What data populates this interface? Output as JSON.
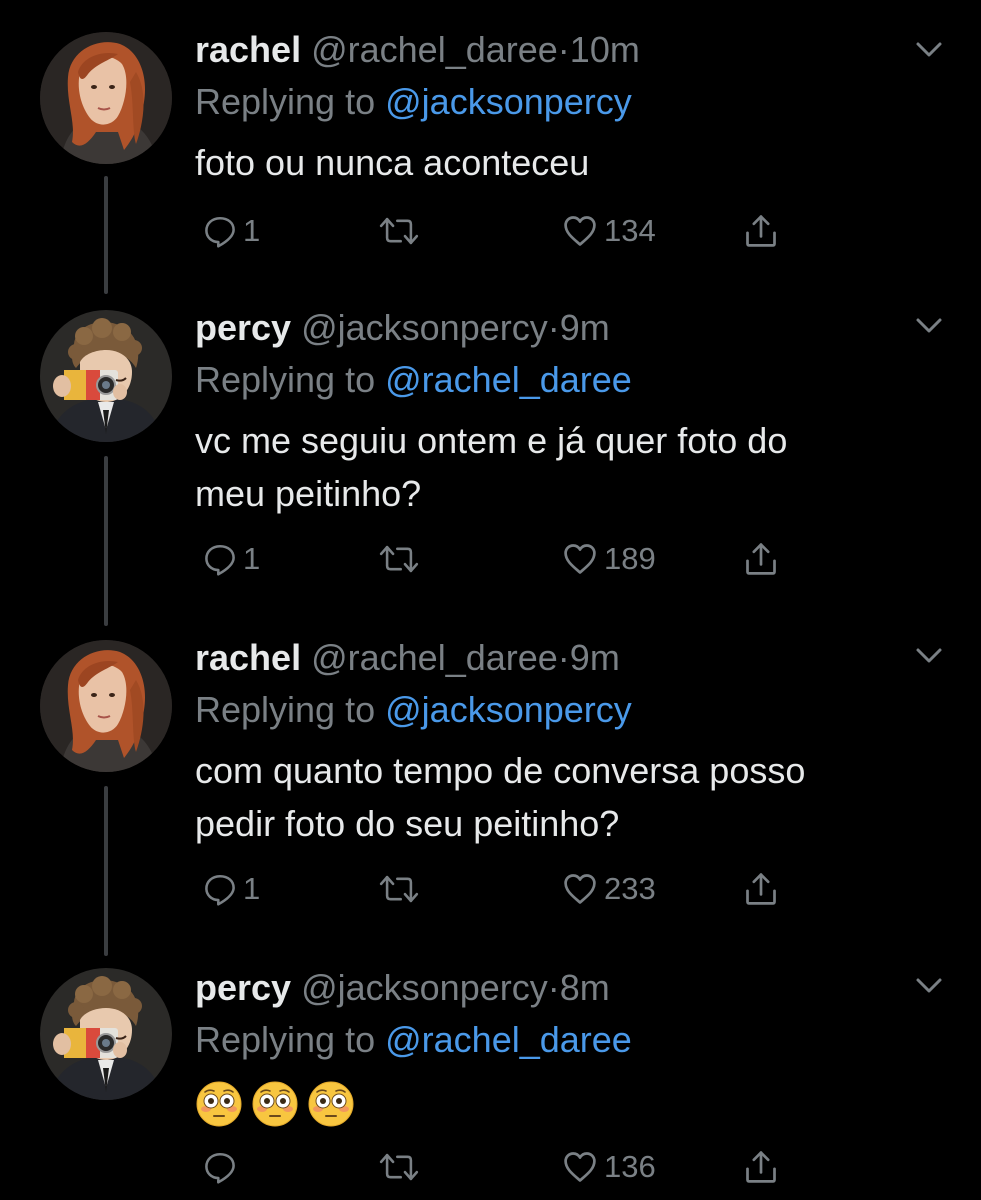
{
  "accent_color": "#4a99e9",
  "tweets": [
    {
      "name": "rachel",
      "handle": "@rachel_daree",
      "separator": "·",
      "time": "10m",
      "replying_prefix": "Replying to",
      "replying_to": "@jacksonpercy",
      "text_lines": [
        "foto ou nunca aconteceu"
      ],
      "reply_count": "1",
      "like_count": "134",
      "avatar_icon": "avatar-red-hair"
    },
    {
      "name": "percy",
      "handle": "@jacksonpercy",
      "separator": "·",
      "time": "9m",
      "replying_prefix": "Replying to",
      "replying_to": "@rachel_daree",
      "text_lines": [
        "vc me seguiu ontem e já quer foto do",
        "meu peitinho?"
      ],
      "reply_count": "1",
      "like_count": "189",
      "avatar_icon": "avatar-camera"
    },
    {
      "name": "rachel",
      "handle": "@rachel_daree",
      "separator": "·",
      "time": "9m",
      "replying_prefix": "Replying to",
      "replying_to": "@jacksonpercy",
      "text_lines": [
        "com quanto tempo de conversa posso",
        "pedir foto do seu peitinho?"
      ],
      "reply_count": "1",
      "like_count": "233",
      "avatar_icon": "avatar-red-hair"
    },
    {
      "name": "percy",
      "handle": "@jacksonpercy",
      "separator": "·",
      "time": "8m",
      "replying_prefix": "Replying to",
      "replying_to": "@rachel_daree",
      "emoji": [
        "flushed-face-emoji",
        "flushed-face-emoji",
        "flushed-face-emoji"
      ],
      "reply_count": "",
      "like_count": "136",
      "avatar_icon": "avatar-camera"
    }
  ]
}
